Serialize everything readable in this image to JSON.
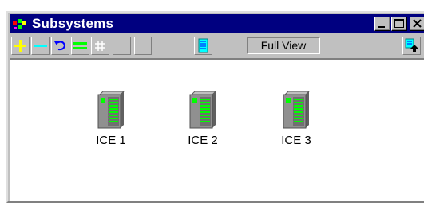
{
  "window": {
    "title": "Subsystems"
  },
  "toolbar": {
    "view_mode": "Full View",
    "buttons": [
      {
        "name": "add",
        "icon": "plus-icon",
        "color": "#ffff00"
      },
      {
        "name": "remove",
        "icon": "minus-icon",
        "color": "#00ffff"
      },
      {
        "name": "undo",
        "icon": "undo-icon",
        "color": "#0000ff"
      },
      {
        "name": "equal",
        "icon": "equals-icon",
        "color": "#00ff00"
      },
      {
        "name": "grid",
        "icon": "grid-icon",
        "color": "#ffffff"
      },
      {
        "name": "list",
        "icon": "list-icon",
        "color": "#00ffff"
      },
      {
        "name": "export",
        "icon": "export-icon",
        "color": "#00ffff"
      }
    ]
  },
  "subsystems": [
    {
      "label": "ICE 1",
      "icon": "server-icon"
    },
    {
      "label": "ICE 2",
      "icon": "server-icon"
    },
    {
      "label": "ICE 3",
      "icon": "server-icon"
    }
  ],
  "colors": {
    "titlebar": "#000080",
    "window_face": "#c0c0c0",
    "server_body": "#808080",
    "server_led": "#00ff00"
  }
}
